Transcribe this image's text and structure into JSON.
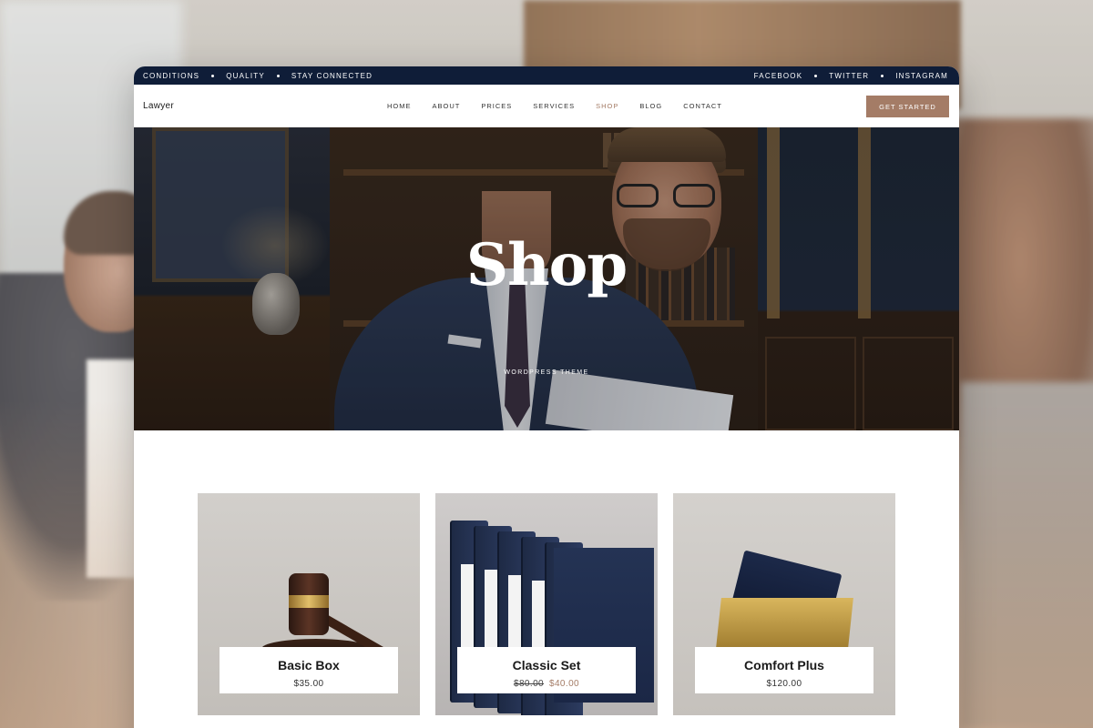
{
  "topbar": {
    "left": [
      "CONDITIONS",
      "QUALITY",
      "STAY CONNECTED"
    ],
    "right": [
      "FACEBOOK",
      "TWITTER",
      "INSTAGRAM"
    ]
  },
  "nav": {
    "brand": "Lawyer",
    "items": [
      "HOME",
      "ABOUT",
      "PRICES",
      "SERVICES",
      "SHOP",
      "BLOG",
      "CONTACT"
    ],
    "active": "SHOP",
    "cta": "GET STARTED"
  },
  "hero": {
    "title": "Shop",
    "subtitle": "WORDPRESS THEME"
  },
  "products": [
    {
      "name": "Basic Box",
      "price": "$35.00"
    },
    {
      "name": "Classic Set",
      "old_price": "$80.00",
      "price": "$40.00"
    },
    {
      "name": "Comfort Plus",
      "price": "$120.00"
    }
  ],
  "colors": {
    "topbar": "#0f1d38",
    "accent": "#a47c66"
  }
}
